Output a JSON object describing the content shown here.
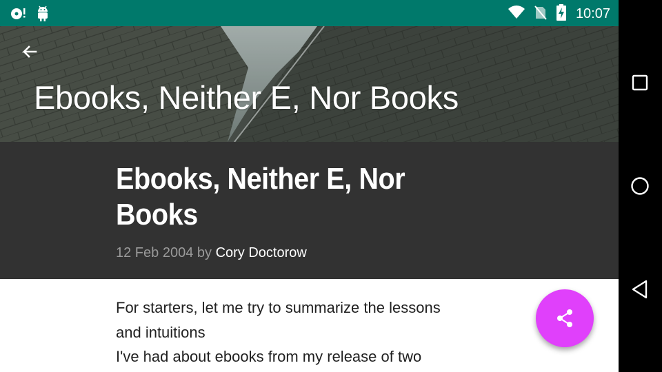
{
  "status_bar": {
    "time": "10:07",
    "icons_left": [
      "record-notification-icon",
      "android-notification-icon"
    ],
    "icons_right": [
      "wifi-icon",
      "no-sim-icon",
      "battery-charging-icon"
    ],
    "color": "#00796b"
  },
  "toolbar": {
    "title": "Ebooks, Neither E, Nor Books",
    "back_icon": "arrow-back-icon"
  },
  "article": {
    "title": "Ebooks, Neither E, Nor Books",
    "date": "12 Feb 2004",
    "by_label": "by",
    "author": "Cory Doctorow",
    "body_lines": [
      "For starters, let me try to summarize the lessons",
      "and intuitions",
      "I've had about ebooks from my release of two"
    ]
  },
  "fab": {
    "icon": "share-icon",
    "color": "#e040fb"
  },
  "nav_bar": {
    "buttons": [
      "recents-square-icon",
      "home-circle-icon",
      "back-triangle-icon"
    ]
  }
}
